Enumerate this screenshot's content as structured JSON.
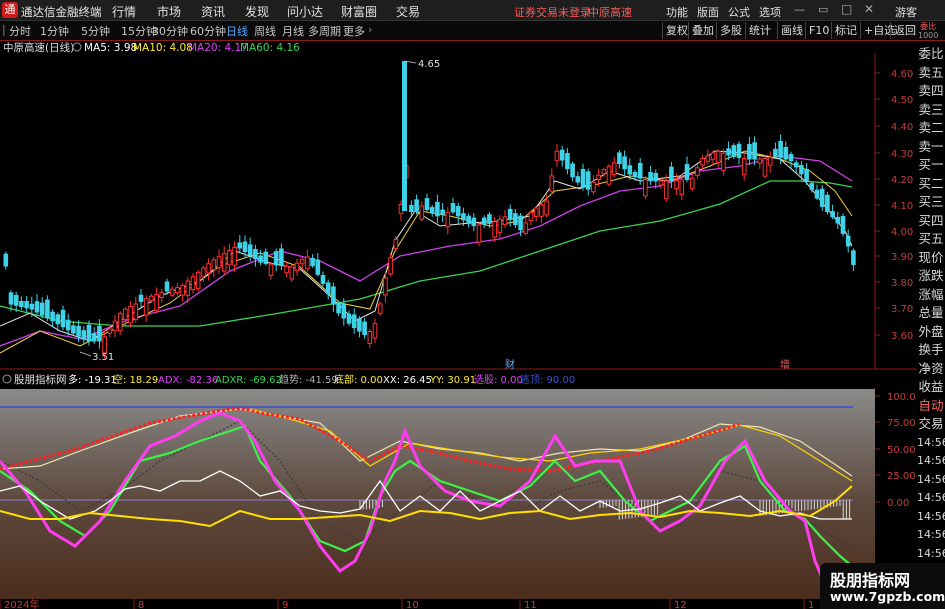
{
  "titlebar": {
    "app_name": "通达信金融终端",
    "menu": [
      "行情",
      "市场",
      "资讯",
      "发现",
      "问小达",
      "财富圈",
      "交易"
    ],
    "notice": "证券交易未登录",
    "stock": "中原高速",
    "right": [
      "功能",
      "版面",
      "公式",
      "选项"
    ],
    "guest": "游客",
    "colors": {
      "notice": "#ff5a5a",
      "bg": "#1e1e1e"
    }
  },
  "toolbar": {
    "periods": [
      "分时",
      "1分钟",
      "5分钟",
      "15分钟",
      "30分钟",
      "60分钟",
      "日线",
      "周线",
      "月线",
      "多周期",
      "更多"
    ],
    "active_period": "日线",
    "right": [
      "复权",
      "叠加",
      "多股",
      "统计",
      "画线",
      "F10",
      "标记",
      "+自选",
      "返回"
    ],
    "side_top": "委比",
    "side_sub": "1000"
  },
  "main_header": {
    "stock": "中原高速(日线)",
    "ma": [
      {
        "label": "MA5: 3.98",
        "color": "#ffffff"
      },
      {
        "label": "MA10: 4.08",
        "color": "#ffeb3b"
      },
      {
        "label": "MA20: 4.17",
        "color": "#e040fb"
      },
      {
        "label": "MA60: 4.16",
        "color": "#39d353"
      }
    ]
  },
  "price_axis": [
    "4.60",
    "4.50",
    "4.40",
    "4.30",
    "4.20",
    "4.10",
    "4.00",
    "3.90",
    "3.80",
    "3.70",
    "3.60"
  ],
  "annotations": {
    "high": "4.65",
    "low": "3.51",
    "mark1": "财",
    "mark2": "增"
  },
  "indicator_header": {
    "name": "股朋指标网",
    "items": [
      {
        "label": "多: -19.31",
        "color": "#ffffff"
      },
      {
        "label": "空: 18.29",
        "color": "#ffeb3b"
      },
      {
        "label": "ADX: -82.36",
        "color": "#e040fb"
      },
      {
        "label": "ADXR: -69.62",
        "color": "#39d353"
      },
      {
        "label": "趋势: -41.59",
        "color": "#b0b0b0"
      },
      {
        "label": "底部: 0.00",
        "color": "#ffeb3b"
      },
      {
        "label": "XX: 26.45",
        "color": "#ffffff"
      },
      {
        "label": "YY: 30.91",
        "color": "#ffeb3b"
      },
      {
        "label": "选股: 0.00",
        "color": "#e040fb"
      },
      {
        "label": "逃顶: 90.00",
        "color": "#3a4fd6"
      }
    ]
  },
  "indicator_axis": [
    "100.0",
    "75.00",
    "50.00",
    "25.00",
    "0.00"
  ],
  "date_axis": [
    "2024年",
    "8",
    "9",
    "10",
    "11",
    "12",
    "1"
  ],
  "side_panel": [
    "委比",
    "卖五",
    "卖四",
    "卖三",
    "卖二",
    "卖一",
    "买一",
    "买二",
    "买三",
    "买四",
    "买五",
    "现价",
    "涨跌",
    "涨幅",
    "总量",
    "外盘",
    "换手",
    "净资",
    "收益",
    "自动",
    "交易",
    "14:56",
    "14:56",
    "14:56",
    "14:56",
    "14:56",
    "14:56",
    "14:56",
    "14:56"
  ],
  "watermark": {
    "title": "股朋指标网",
    "url": "www.7gpzb.com"
  }
}
